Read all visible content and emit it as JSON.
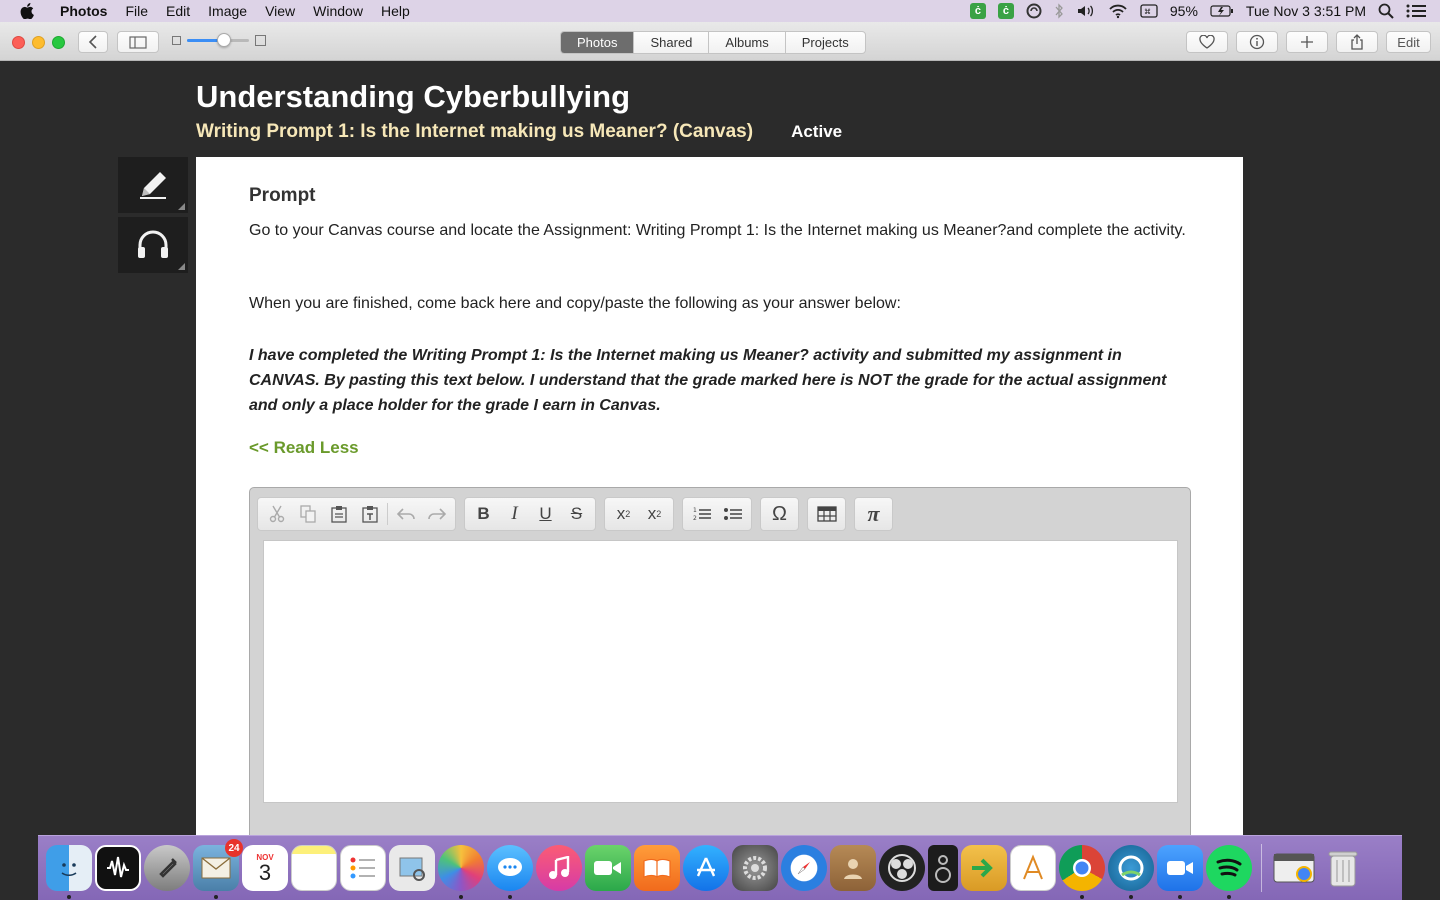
{
  "menubar": {
    "app_name": "Photos",
    "menus": [
      "File",
      "Edit",
      "Image",
      "View",
      "Window",
      "Help"
    ],
    "status": {
      "battery": "95%",
      "datetime": "Tue Nov 3  3:51 PM"
    }
  },
  "toolbar": {
    "tabs": [
      {
        "label": "Photos",
        "active": true
      },
      {
        "label": "Shared",
        "active": false
      },
      {
        "label": "Albums",
        "active": false
      },
      {
        "label": "Projects",
        "active": false
      }
    ],
    "edit_label": "Edit",
    "zoom_level": 0.6
  },
  "page": {
    "title": "Understanding Cyberbullying",
    "subtitle": "Writing Prompt 1: Is the Internet making us Meaner? (Canvas)",
    "status": "Active"
  },
  "side_tools": [
    {
      "icon": "pencil-icon"
    },
    {
      "icon": "headphones-icon"
    }
  ],
  "prompt": {
    "heading": "Prompt",
    "p1": "Go to your Canvas course and locate the Assignment: Writing Prompt 1: Is the Internet making us Meaner?and complete the activity.",
    "p2": "When you are finished, come back here and copy/paste the following as your answer below:",
    "p3": "I have completed the Writing Prompt 1: Is the Internet making us Meaner? activity and submitted my assignment in CANVAS. By pasting this text below. I understand that the grade marked here is NOT the grade for the actual assignment and only a place holder for the grade I earn in Canvas.",
    "read_less": "<< Read Less"
  },
  "editor": {
    "tools": {
      "cut": "cut-icon",
      "copy": "copy-icon",
      "paste": "paste-icon",
      "paste_text": "paste-text-icon",
      "undo": "undo-icon",
      "redo": "redo-icon",
      "bold": "B",
      "italic": "I",
      "underline": "U",
      "strike": "S",
      "subscript_base": "x",
      "subscript_mark": "2",
      "superscript_base": "x",
      "superscript_mark": "2",
      "omega": "Ω",
      "pi": "π"
    }
  },
  "dock": {
    "mail_badge": "24",
    "calendar_month": "NOV",
    "calendar_day": "3"
  },
  "colors": {
    "accent_link": "#6a9a2b",
    "subtitle": "#f6e7b8",
    "menubar_bg": "#ddd3e7",
    "dock_bg": "#8467b6"
  }
}
